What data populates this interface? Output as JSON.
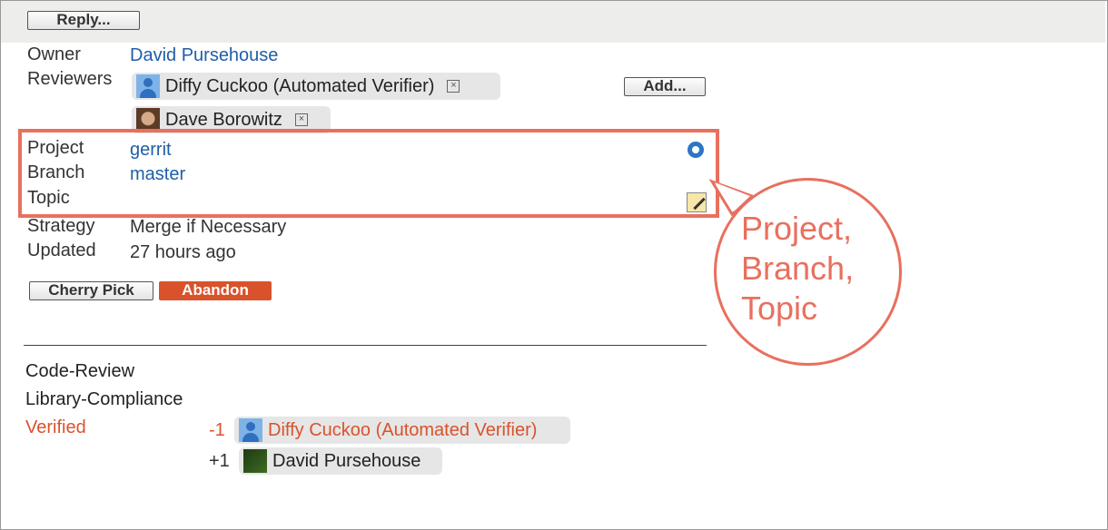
{
  "buttons": {
    "reply": "Reply...",
    "add": "Add...",
    "cherry_pick": "Cherry Pick",
    "abandon": "Abandon"
  },
  "info": {
    "owner_label": "Owner",
    "owner": "David Pursehouse",
    "reviewers_label": "Reviewers",
    "reviewers": [
      {
        "name": "Diffy Cuckoo (Automated Verifier)",
        "avatar": "person-icon"
      },
      {
        "name": "Dave Borowitz",
        "avatar": "user-photo"
      }
    ],
    "project_label": "Project",
    "project": "gerrit",
    "branch_label": "Branch",
    "branch": "master",
    "topic_label": "Topic",
    "topic": "",
    "strategy_label": "Strategy",
    "strategy": "Merge if Necessary",
    "updated_label": "Updated",
    "updated": "27 hours ago"
  },
  "labels": [
    {
      "name": "Code-Review",
      "votes": []
    },
    {
      "name": "Library-Compliance",
      "votes": []
    },
    {
      "name": "Verified",
      "votes": [
        {
          "score": "-1",
          "user": "Diffy Cuckoo (Automated Verifier)"
        },
        {
          "score": "+1",
          "user": "David Pursehouse"
        }
      ]
    }
  ],
  "callout": "Project,\nBranch,\nTopic",
  "colors": {
    "link": "#1f5ea8",
    "accent_red": "#d8532c",
    "highlight": "#e8705f"
  }
}
